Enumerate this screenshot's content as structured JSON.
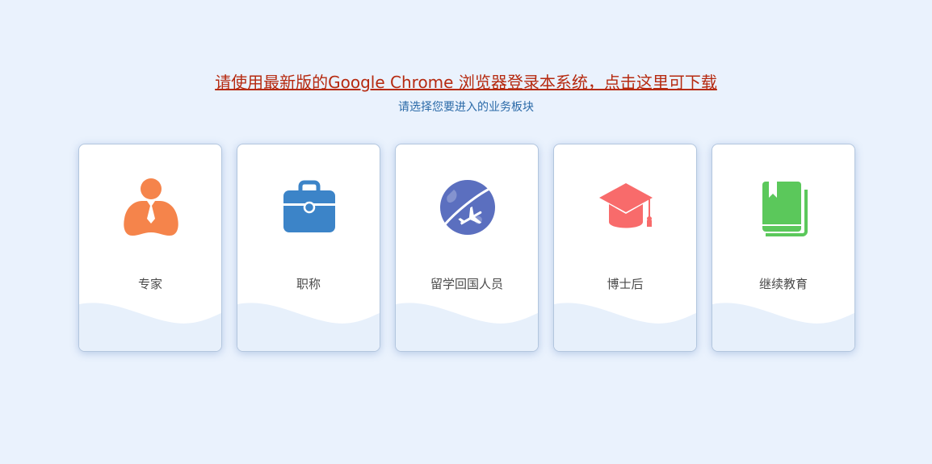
{
  "notice": {
    "text": "请使用最新版的Google Chrome 浏览器登录本系统，点击这里可下载",
    "color": "#b62a10"
  },
  "subtitle": "请选择您要进入的业务板块",
  "cards": [
    {
      "label": "专家",
      "icon": "expert-person-icon",
      "color": "#f5844b"
    },
    {
      "label": "职称",
      "icon": "briefcase-icon",
      "color": "#3c84c8"
    },
    {
      "label": "留学回国人员",
      "icon": "globe-airplane-icon",
      "color": "#5b6fbf"
    },
    {
      "label": "博士后",
      "icon": "graduation-cap-icon",
      "color": "#f86b6b"
    },
    {
      "label": "继续教育",
      "icon": "book-icon",
      "color": "#5bc85b"
    }
  ],
  "colors": {
    "page_background": "#eaf2fd",
    "card_background": "#ffffff",
    "wave": "#e7f0fb"
  }
}
